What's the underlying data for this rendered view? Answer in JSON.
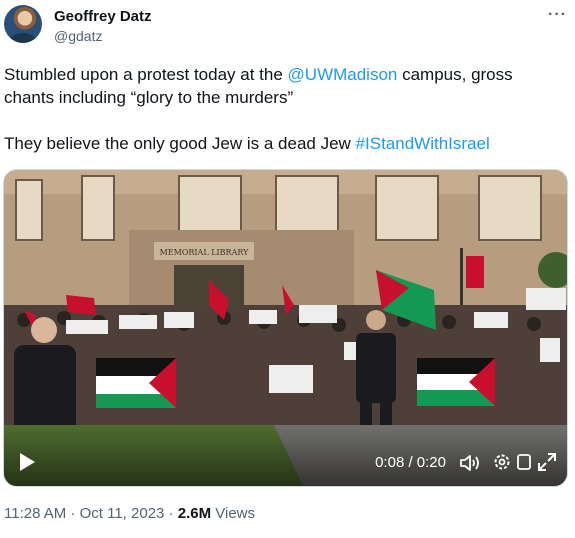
{
  "author": {
    "display_name": "Geoffrey Datz",
    "handle": "@gdatz",
    "more_label": "···"
  },
  "tweet": {
    "line1_prefix": "Stumbled upon a protest today at the ",
    "mention": "@UWMadison",
    "line1_suffix": " campus, gross",
    "line2": "chants including “glory to the murders”",
    "line3_prefix": "They believe the only good Jew is a dead Jew ",
    "hashtag": "#IStandWithIsrael"
  },
  "video": {
    "building_sign": "MEMORIAL LIBRARY",
    "time": "0:08 / 0:20",
    "icons": [
      "play-icon",
      "volume-icon",
      "settings-icon",
      "closed-captions-icon",
      "fullscreen-icon"
    ]
  },
  "meta": {
    "time": "11:28 AM",
    "separator1": " · ",
    "date": "Oct 11, 2023",
    "separator2": " · ",
    "views_count": "2.6M",
    "views_label": " Views"
  },
  "colors": {
    "link": "#1d9bf0",
    "secondary_text": "#536471",
    "flag_red": "#c8102e",
    "flag_green": "#149954"
  }
}
